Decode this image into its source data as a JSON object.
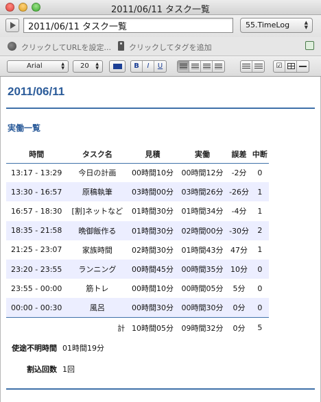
{
  "window": {
    "title": "2011/06/11 タスク一覧"
  },
  "note": {
    "title_value": "2011/06/11 タスク一覧",
    "notebook": "55.TimeLog",
    "url_placeholder": "クリックしてURLを設定...",
    "tag_placeholder": "クリックしてタグを追加"
  },
  "toolbar": {
    "font": "Arial",
    "size": "20",
    "text_color": "#1c3f95",
    "bold": "B",
    "italic": "I",
    "underline": "U"
  },
  "doc": {
    "date_heading": "2011/06/11",
    "section_heading": "実働一覧",
    "columns": [
      "時間",
      "タスク名",
      "見積",
      "実働",
      "誤差",
      "中断"
    ],
    "rows": [
      {
        "time": "13:17 - 13:29",
        "task": "今日の計画",
        "estimate": "00時間10分",
        "actual": "00時間12分",
        "diff": "-2分",
        "diff_sign": "neg",
        "interrupts": "0"
      },
      {
        "time": "13:30 - 16:57",
        "task": "原稿執筆",
        "estimate": "03時間00分",
        "actual": "03時間26分",
        "diff": "-26分",
        "diff_sign": "neg",
        "interrupts": "1"
      },
      {
        "time": "16:57 - 18:30",
        "task": "[割]ネットなど",
        "estimate": "01時間30分",
        "actual": "01時間34分",
        "diff": "-4分",
        "diff_sign": "neg",
        "interrupts": "1"
      },
      {
        "time": "18:35 - 21:58",
        "task": "晩御飯作る",
        "estimate": "01時間30分",
        "actual": "02時間00分",
        "diff": "-30分",
        "diff_sign": "neg",
        "interrupts": "2"
      },
      {
        "time": "21:25 - 23:07",
        "task": "家族時間",
        "estimate": "02時間30分",
        "actual": "01時間43分",
        "diff": "47分",
        "diff_sign": "pos",
        "interrupts": "1"
      },
      {
        "time": "23:20 - 23:55",
        "task": "ランニング",
        "estimate": "00時間45分",
        "actual": "00時間35分",
        "diff": "10分",
        "diff_sign": "pos",
        "interrupts": "0"
      },
      {
        "time": "23:55 - 00:00",
        "task": "筋トレ",
        "estimate": "00時間10分",
        "actual": "00時間05分",
        "diff": "5分",
        "diff_sign": "pos",
        "interrupts": "0"
      },
      {
        "time": "00:00 - 00:30",
        "task": "風呂",
        "estimate": "00時間30分",
        "actual": "00時間30分",
        "diff": "0分",
        "diff_sign": "pos",
        "interrupts": "0"
      }
    ],
    "total": {
      "label": "計",
      "estimate": "10時間05分",
      "actual": "09時間32分",
      "diff": "0分",
      "interrupts": "5"
    },
    "unknown_label": "使途不明時間",
    "unknown_value": "01時間19分",
    "interrupt_count_label": "割込回数",
    "interrupt_count_value": "1回"
  },
  "colors": {
    "accent": "#2c5c9a",
    "negative": "#e00000",
    "positive": "#1010e0",
    "row_alt": "#eceeff"
  }
}
